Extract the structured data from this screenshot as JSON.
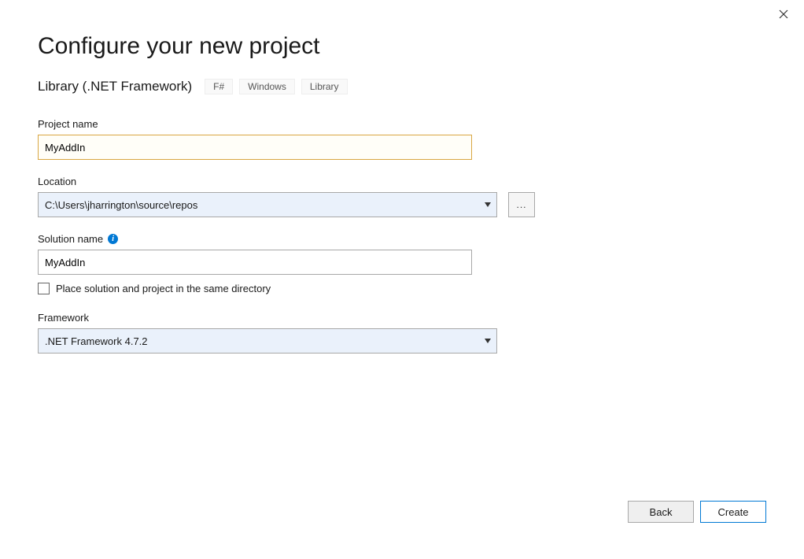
{
  "title": "Configure your new project",
  "template": {
    "name": "Library (.NET Framework)",
    "tags": [
      "F#",
      "Windows",
      "Library"
    ]
  },
  "fields": {
    "project_name": {
      "label": "Project name",
      "value": "MyAddIn"
    },
    "location": {
      "label": "Location",
      "value": "C:\\Users\\jharrington\\source\\repos",
      "browse_label": "..."
    },
    "solution_name": {
      "label": "Solution name",
      "value": "MyAddIn"
    },
    "same_directory": {
      "label": "Place solution and project in the same directory",
      "checked": false
    },
    "framework": {
      "label": "Framework",
      "value": ".NET Framework 4.7.2"
    }
  },
  "buttons": {
    "back": "Back",
    "create": "Create"
  }
}
